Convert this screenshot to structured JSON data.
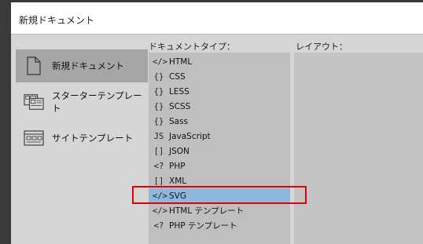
{
  "window": {
    "title": "新規ドキュメント"
  },
  "sidebar": {
    "items": [
      {
        "label": "新規ドキュメント",
        "icon": "document-icon"
      },
      {
        "label": "スターターテンプレート",
        "icon": "starter-template-icon"
      },
      {
        "label": "サイトテンプレート",
        "icon": "site-template-icon"
      }
    ]
  },
  "columns": {
    "types_header": "ドキュメントタイプ：",
    "layout_header": "レイアウト："
  },
  "document_types": [
    {
      "label": "HTML",
      "icon": "</>"
    },
    {
      "label": "CSS",
      "icon": "{}"
    },
    {
      "label": "LESS",
      "icon": "{}"
    },
    {
      "label": "SCSS",
      "icon": "{}"
    },
    {
      "label": "Sass",
      "icon": "{}"
    },
    {
      "label": "JavaScript",
      "icon": "JS"
    },
    {
      "label": "JSON",
      "icon": "[]"
    },
    {
      "label": "PHP",
      "icon": "<?"
    },
    {
      "label": "XML",
      "icon": "[]"
    },
    {
      "label": "SVG",
      "icon": "</>"
    },
    {
      "label": "HTML テンプレート",
      "icon": "</>"
    },
    {
      "label": "PHP テンプレート",
      "icon": "<?"
    }
  ],
  "selected_type": "SVG"
}
